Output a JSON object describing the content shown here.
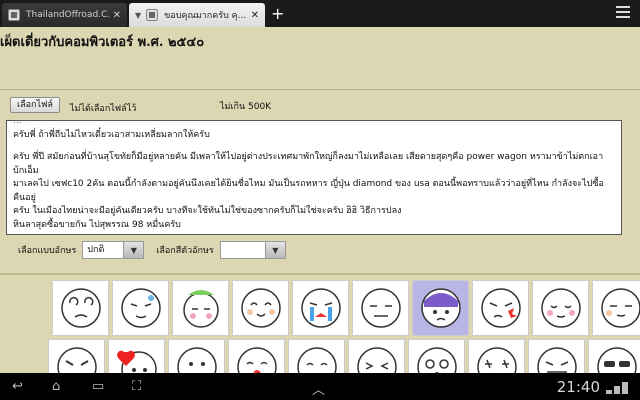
{
  "tabs": [
    {
      "label": "ThailandOffroad.C..."
    },
    {
      "label": "ขอบคุณมากครับ คุ..."
    }
  ],
  "page": {
    "heading": "เผ็ดเดี่ยวกับคอมพิวเตอร์ พ.ศ. ๒๕๔๐",
    "file_button": "เลือกไฟล์",
    "no_file": "ไม่ได้เลือกไฟล์ไว้",
    "size_limit": "ไม่เกิน 500K",
    "editor": {
      "cut_line": "...",
      "para1": "ครับพี่ ถ้าพี่ถีบไม่ไหวเดี๋ยวเอาสามเหลี่ยมลากให้ครับ",
      "para2_line1": "ครับ พี่ปี สมัยก่อนที่บ้านสุโขทัยก็มีอยู่หลายคัน มีเพลาให้ไปอยู่ต่างประเทศมาพักใหญ่ก็ลงมาไม่เหลือเลย เสียดายสุดๆคือ power wagon หรามาข้าไม่ตกเอา บ้กเอ็ม",
      "para2_line2": "มาเลคไป เซฟc10 2คัน ตอนนี้กำลังตามอยู่คันนึงเคยได้ยินชื่อไหม มันเป็นรถทหาร ญี่ปุ่น diamond ของ usa ตอนนี้พอทราบแล้วว่าอยู่ที่ไหน กำลังจะไปซื้อคืนอยู่",
      "para2_line3": "ครับ ในเมืองไทยน่าจะมีอยู่คันเดียวครับ บางทีจะใช้ทันไม่ใช่ของซากครับก็ไม่ใช่จะครับ ฮิฮิ วิธีการปลง",
      "para2_line4": "หินลาสุดซื้อขายกัน ไปสุพรรณ 98 หมื่นครับ"
    },
    "font_style_label": "เลือกแบบอักษร",
    "font_style_value": "ปกติ",
    "font_color_label": "เลือกสีตัวอักษร",
    "font_color_value": ""
  },
  "emoticons": {
    "row1": [
      "dizzy",
      "wink-sweat",
      "crying-green",
      "happy-eyes-closed",
      "crying-tears",
      "smirk",
      "purple-shock",
      "angry-red",
      "shy-sweat",
      "calm"
    ],
    "row2": [
      "angry-mad",
      "heart-blush",
      "drool",
      "singing",
      "kiss",
      "happy-laugh",
      "surprised",
      "star-eyes",
      "evil-grin",
      "cool"
    ]
  },
  "system": {
    "clock": "21:40"
  },
  "colors": {
    "page_bg": "#dcd6b2",
    "selected_emoticon": "#b9b6e6"
  }
}
